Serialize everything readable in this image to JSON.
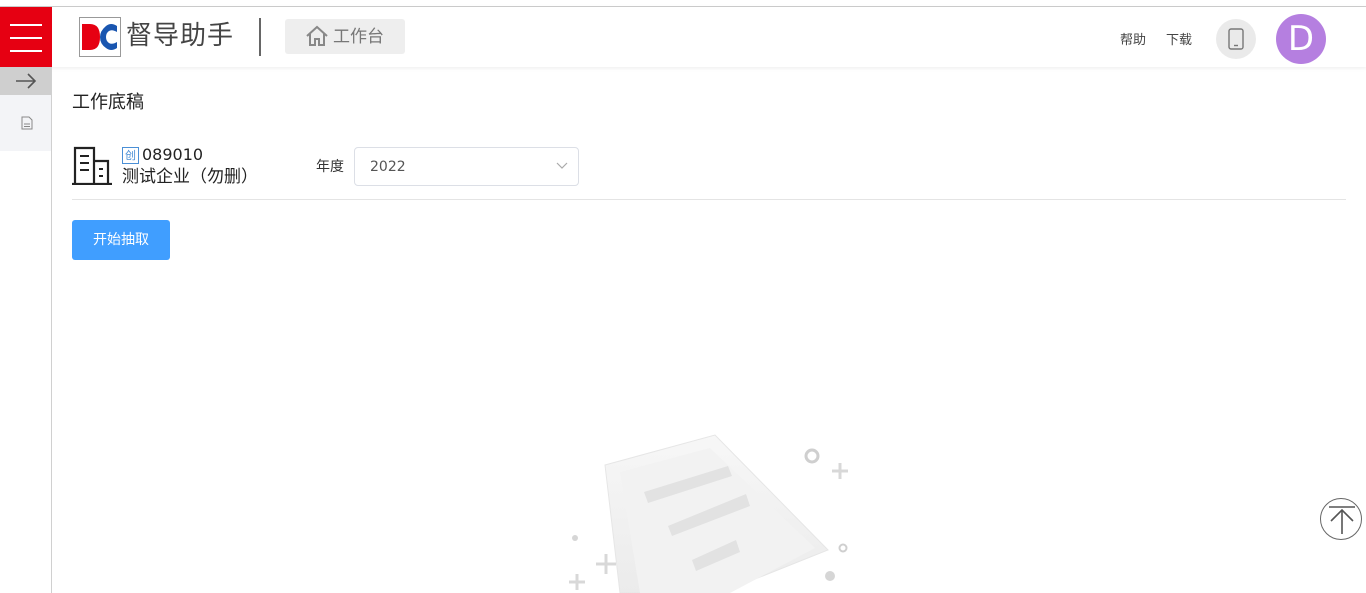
{
  "header": {
    "brand": "督导助手",
    "workbench_label": "工作台",
    "help_label": "帮助",
    "download_label": "下载",
    "avatar_initial": "D",
    "accent_red": "#e60012",
    "avatar_color": "#b57fe0"
  },
  "main": {
    "page_title": "工作底稿",
    "company": {
      "tag": "创",
      "code": "089010",
      "name": "测试企业（勿删）"
    },
    "year_label": "年度",
    "year_value": "2022",
    "start_button": "开始抽取",
    "primary_color": "#409eff"
  },
  "icons": {
    "menu": "hamburger-icon",
    "home": "home-icon",
    "phone": "mobile-phone-icon",
    "collapse": "arrow-right-icon",
    "sidebar_doc": "document-icon",
    "company": "building-icon",
    "select_arrow": "chevron-down-icon",
    "back_to_top": "arrow-up-icon",
    "empty_state": "empty-document-illustration"
  }
}
